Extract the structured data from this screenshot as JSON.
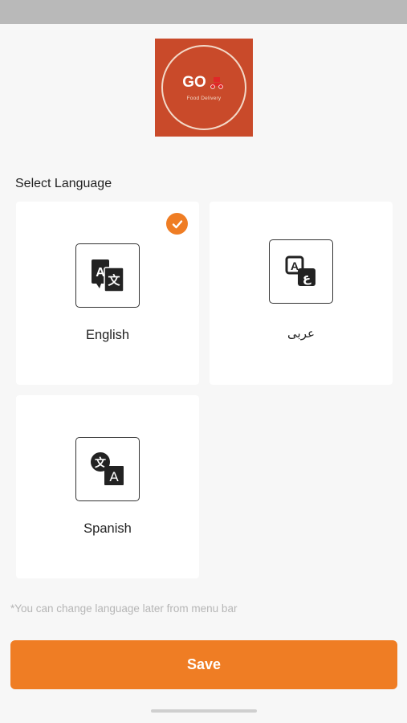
{
  "logo": {
    "brand": "GO",
    "tagline": "Food Delivery"
  },
  "section_title": "Select Language",
  "languages": [
    {
      "label": "English",
      "icon": "translate-icon",
      "selected": true
    },
    {
      "label": "عربى",
      "icon": "arabic-translate-icon",
      "selected": false
    },
    {
      "label": "Spanish",
      "icon": "translate-icon",
      "selected": false
    }
  ],
  "hint": "*You can change language later from menu bar",
  "save_label": "Save",
  "colors": {
    "accent": "#ef7d24",
    "logo_background": "#c94a2a",
    "hint_text": "#b6b6b6"
  }
}
